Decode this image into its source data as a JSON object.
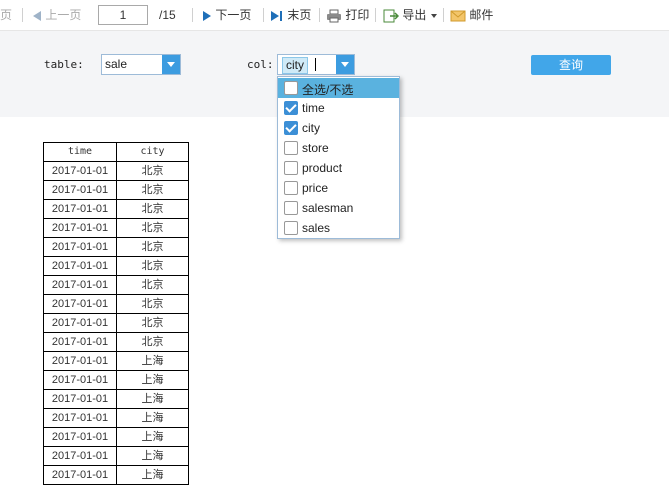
{
  "toolbar": {
    "first_label": "页",
    "prev_label": "上一页",
    "page_value": "1",
    "page_total": "/15",
    "next_label": "下一页",
    "last_label": "末页",
    "print_label": "打印",
    "export_label": "导出",
    "mail_label": "邮件"
  },
  "params": {
    "table_label": "table:",
    "table_value": "sale",
    "col_label": "col:",
    "col_chip": "city",
    "query_label": "查询"
  },
  "dropdown": {
    "select_all": "全选/不选",
    "items": [
      {
        "label": "time",
        "checked": true
      },
      {
        "label": "city",
        "checked": true
      },
      {
        "label": "store",
        "checked": false
      },
      {
        "label": "product",
        "checked": false
      },
      {
        "label": "price",
        "checked": false
      },
      {
        "label": "salesman",
        "checked": false
      },
      {
        "label": "sales",
        "checked": false
      }
    ]
  },
  "report": {
    "headers": [
      "time",
      "city"
    ],
    "rows": [
      [
        "2017-01-01",
        "北京"
      ],
      [
        "2017-01-01",
        "北京"
      ],
      [
        "2017-01-01",
        "北京"
      ],
      [
        "2017-01-01",
        "北京"
      ],
      [
        "2017-01-01",
        "北京"
      ],
      [
        "2017-01-01",
        "北京"
      ],
      [
        "2017-01-01",
        "北京"
      ],
      [
        "2017-01-01",
        "北京"
      ],
      [
        "2017-01-01",
        "北京"
      ],
      [
        "2017-01-01",
        "北京"
      ],
      [
        "2017-01-01",
        "上海"
      ],
      [
        "2017-01-01",
        "上海"
      ],
      [
        "2017-01-01",
        "上海"
      ],
      [
        "2017-01-01",
        "上海"
      ],
      [
        "2017-01-01",
        "上海"
      ],
      [
        "2017-01-01",
        "上海"
      ],
      [
        "2017-01-01",
        "上海"
      ]
    ]
  },
  "colors": {
    "accent": "#41a6e9",
    "dropdown_header": "#5ab2df",
    "panel_bg": "#f4f5f7"
  }
}
